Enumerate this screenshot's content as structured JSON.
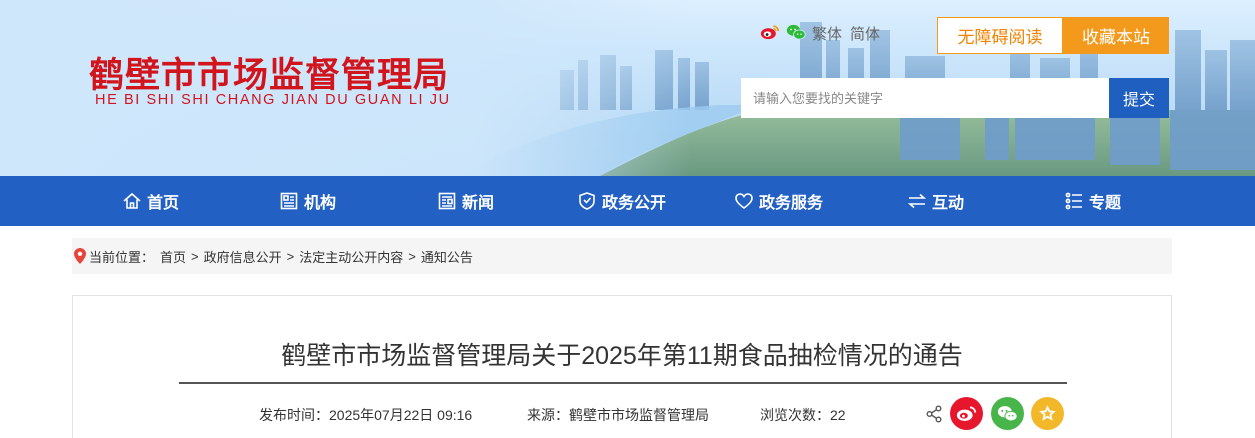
{
  "site": {
    "name_cn": "鹤壁市市场监督管理局",
    "name_en": "HE BI SHI SHI CHANG JIAN DU GUAN LI JU",
    "colors": {
      "brand_red": "#d2141d",
      "nav_blue": "#2360c3",
      "accent_orange": "#f39a1c"
    }
  },
  "header": {
    "social_icons": [
      "weibo-icon",
      "wechat-icon"
    ],
    "lang_traditional": "繁体",
    "lang_simplified": "简体",
    "accessibility_label": "无障碍阅读",
    "favorite_label": "收藏本站",
    "search": {
      "placeholder": "请输入您要找的关键字",
      "value": "",
      "submit_label": "提交"
    }
  },
  "nav": {
    "items": [
      {
        "label": "首页",
        "icon": "home-icon"
      },
      {
        "label": "机构",
        "icon": "org-icon"
      },
      {
        "label": "新闻",
        "icon": "news-icon"
      },
      {
        "label": "政务公开",
        "icon": "shield-icon"
      },
      {
        "label": "政务服务",
        "icon": "heart-icon"
      },
      {
        "label": "互动",
        "icon": "exchange-icon"
      },
      {
        "label": "专题",
        "icon": "list-icon"
      }
    ]
  },
  "breadcrumb": {
    "prefix": "当前位置：",
    "items": [
      "首页",
      "政府信息公开",
      "法定主动公开内容",
      "通知公告"
    ],
    "separator": ">"
  },
  "article": {
    "title": "鹤壁市市场监督管理局关于2025年第11期食品抽检情况的通告",
    "publish_label": "发布时间：",
    "publish_time": "2025年07月22日 09:16",
    "source_label": "来源：",
    "source": "鹤壁市市场监督管理局",
    "views_label": "浏览次数：",
    "views": "22",
    "share_icons": [
      "share-icon",
      "weibo-icon",
      "wechat-icon",
      "favorite-star-icon"
    ]
  }
}
